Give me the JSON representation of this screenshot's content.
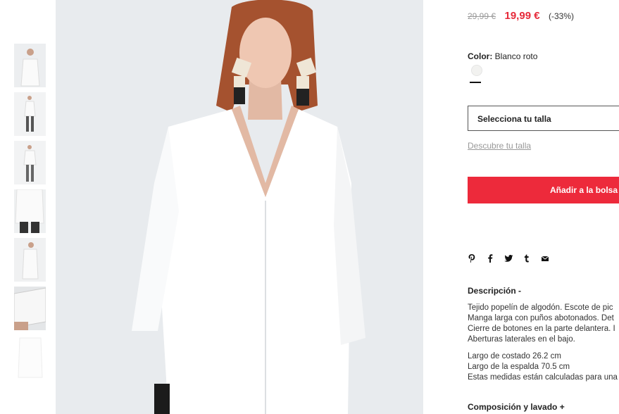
{
  "thumbnails": [
    {
      "label": "thumbnail-1"
    },
    {
      "label": "thumbnail-2"
    },
    {
      "label": "thumbnail-3"
    },
    {
      "label": "thumbnail-4"
    },
    {
      "label": "thumbnail-5"
    },
    {
      "label": "thumbnail-6"
    },
    {
      "label": "thumbnail-7"
    }
  ],
  "product": {
    "old_price": "29,99 €",
    "new_price": "19,99 €",
    "discount": "(-33%)",
    "color_label": "Color:",
    "color_value": "Blanco roto",
    "size_placeholder": "Selecciona tu talla",
    "size_link": "Descubre tu talla",
    "add_to_bag": "Añadir a la bolsa"
  },
  "share_icons": [
    "pinterest-icon",
    "facebook-icon",
    "twitter-icon",
    "tumblr-icon",
    "email-icon"
  ],
  "description": {
    "title": "Descripción -",
    "lines": [
      "Tejido popelín de algodón. Escote de pic",
      "Manga larga con puños abotonados. Det",
      "Cierre de botones en la parte delantera. I",
      "Aberturas laterales en el bajo."
    ],
    "measures": [
      "Largo de costado 26.2 cm",
      "Largo de la espalda 70.5 cm",
      "Estas medidas están calculadas para una"
    ]
  },
  "composition": "Composición y lavado +",
  "colors": {
    "accent": "#ed2a3b",
    "price": "#e62a3a"
  }
}
